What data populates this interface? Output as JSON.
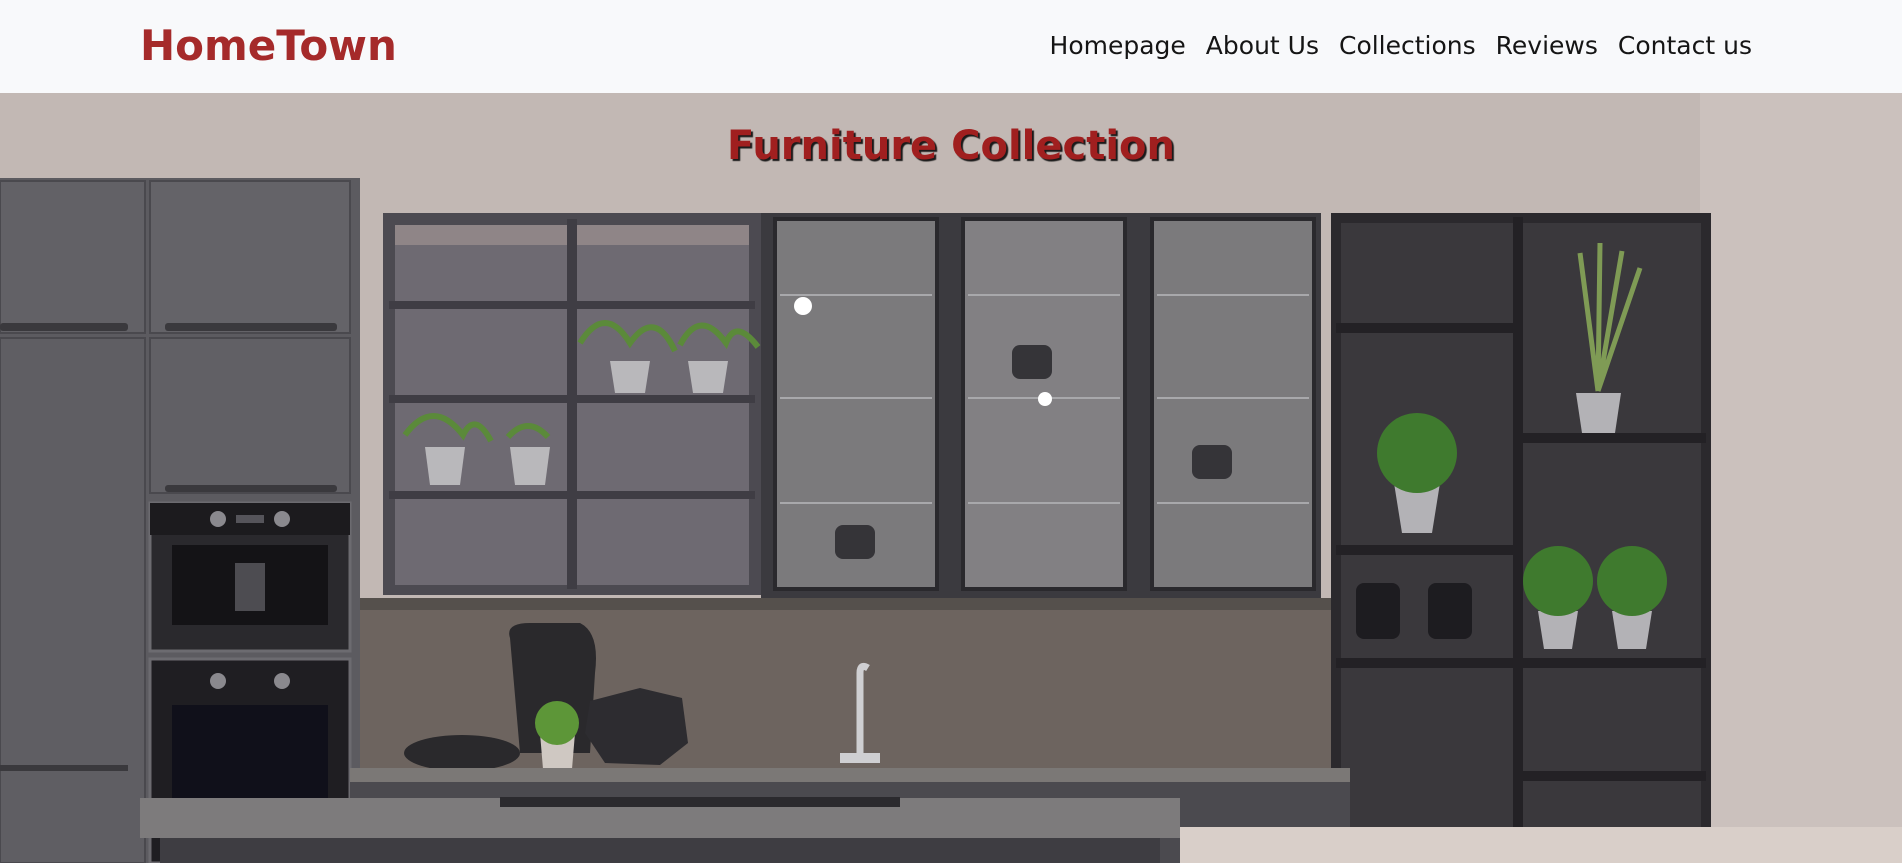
{
  "navbar": {
    "brand": "HomeTown",
    "links": [
      {
        "label": "Homepage"
      },
      {
        "label": "About Us"
      },
      {
        "label": "Collections"
      },
      {
        "label": "Reviews"
      },
      {
        "label": "Contact us"
      }
    ]
  },
  "hero": {
    "title": "Furniture Collection",
    "image_alt_icon": "kitchen-photo"
  },
  "colors": {
    "brand": "#a52a2a",
    "nav_bg": "#f8f9fb",
    "nav_text": "#151515"
  }
}
